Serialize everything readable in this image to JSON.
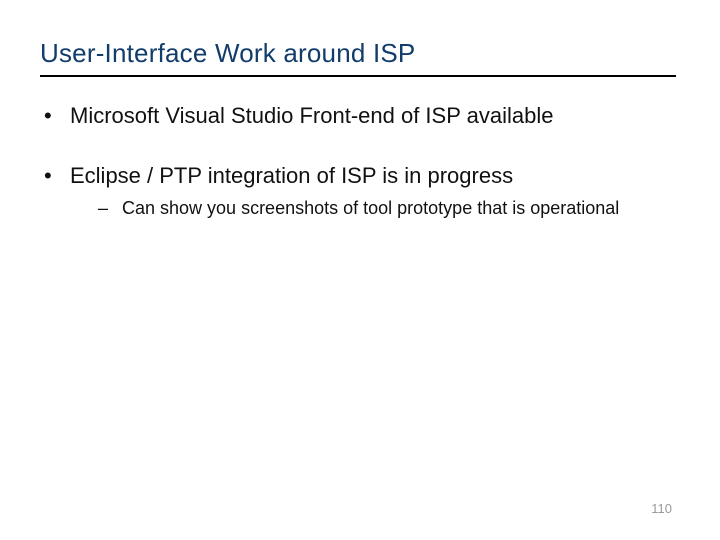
{
  "title": "User-Interface Work around ISP",
  "bullets": [
    {
      "text": "Microsoft Visual Studio Front-end of ISP available",
      "children": []
    },
    {
      "text": "Eclipse / PTP integration of ISP is in progress",
      "children": [
        {
          "text": "Can show you screenshots of tool prototype that is operational"
        }
      ]
    }
  ],
  "page_number": "110"
}
